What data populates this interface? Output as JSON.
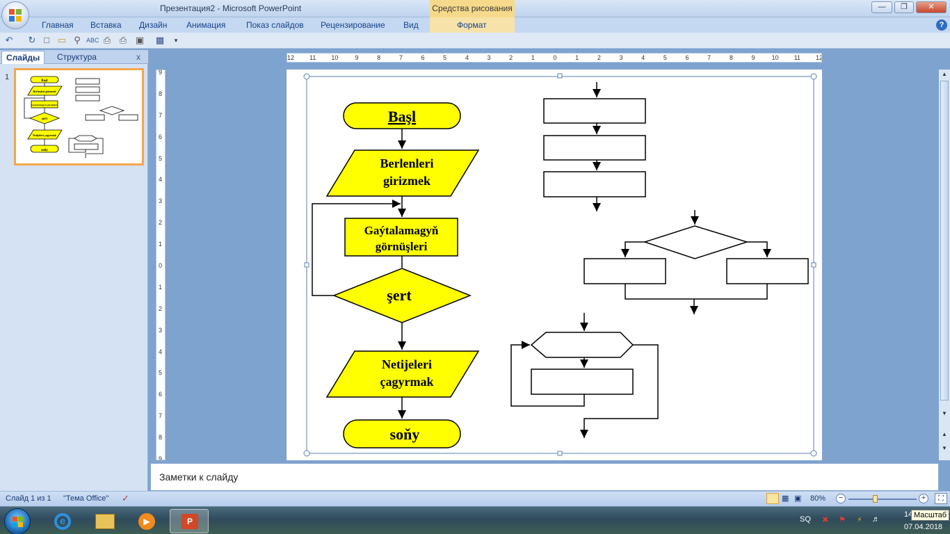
{
  "window": {
    "title": "Презентация2 - Microsoft PowerPoint",
    "context_title": "Средства рисования",
    "controls": [
      "minimize",
      "maximize",
      "close"
    ]
  },
  "ribbon": {
    "tabs": [
      "Главная",
      "Вставка",
      "Дизайн",
      "Анимация",
      "Показ слайдов",
      "Рецензирование",
      "Вид"
    ],
    "context_tab": "Формат"
  },
  "quick_access": {
    "icons": [
      "undo-icon",
      "redo-icon",
      "new-icon",
      "open-icon",
      "print-preview-icon",
      "spelling-icon",
      "quick-print-icon",
      "print-icon",
      "layout-icon",
      "save-icon",
      "customize-icon"
    ]
  },
  "left_panel": {
    "tabs": [
      "Слайды",
      "Структура"
    ],
    "close": "x",
    "slide_number": "1",
    "thumb": {
      "start": "Başl",
      "input": "Berlenleri girizmek",
      "process": "Gaýtalamagyň görnüşleri",
      "condition": "şert",
      "output": "Netijeleri çagyrmak",
      "end": "soňy"
    }
  },
  "ruler": {
    "h_labels": [
      "12",
      "11",
      "10",
      "9",
      "8",
      "7",
      "6",
      "5",
      "4",
      "3",
      "2",
      "1",
      "0",
      "1",
      "2",
      "3",
      "4",
      "5",
      "6",
      "7",
      "8",
      "9",
      "10",
      "11",
      "12"
    ],
    "v_labels": [
      "9",
      "8",
      "7",
      "6",
      "5",
      "4",
      "3",
      "2",
      "1",
      "0",
      "1",
      "2",
      "3",
      "4",
      "5",
      "6",
      "7",
      "8",
      "9"
    ]
  },
  "slide": {
    "flow": {
      "start": "Başl",
      "input_line1": "Berlenleri",
      "input_line2": "girizmek",
      "process_line1": "Gaýtalamagyň",
      "process_line2": "görnüşleri",
      "condition": "şert",
      "output_line1": "Netijeleri",
      "output_line2": "çagyrmak",
      "end": "soňy"
    },
    "colors": {
      "fill": "#ffff00",
      "stroke": "#000000",
      "selection": "#5a7fb5"
    }
  },
  "notes": {
    "placeholder": "Заметки к слайду"
  },
  "status": {
    "slide_info": "Слайд 1 из 1",
    "theme": "\"Тема Office\"",
    "zoom": "80%",
    "zoom_level": 0.8
  },
  "taskbar": {
    "apps": [
      "internet-explorer",
      "file-explorer",
      "media-player",
      "powerpoint"
    ],
    "lang": "SQ",
    "time": "14",
    "date": "07.04.2018",
    "tooltip": "Масштаб"
  }
}
